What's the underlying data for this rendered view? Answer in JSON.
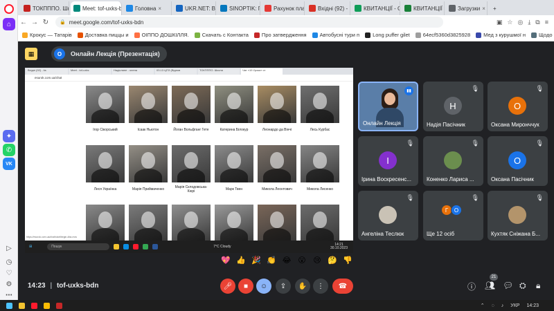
{
  "browser": {
    "tabs": [
      {
        "label": "ТОКПППО. Шко",
        "color": "#c5221f"
      },
      {
        "label": "Meet: tof-uxks-b",
        "color": "#00897b",
        "active": true
      },
      {
        "label": "Головна",
        "color": "#1e88e5"
      },
      {
        "label": "UKR.NET: Всі н",
        "color": "#1565c0"
      },
      {
        "label": "SINOPTIK: Пог",
        "color": "#0277bd"
      },
      {
        "label": "Рахунок платн",
        "color": "#e53935"
      },
      {
        "label": "Вхідні (92) - ks",
        "color": "#d93025"
      },
      {
        "label": "КВИТАНЦІЇ - G",
        "color": "#0f9d58"
      },
      {
        "label": "КВИТАНЦІЇ (Вс",
        "color": "#188038"
      },
      {
        "label": "Загрузки",
        "color": "#5f6368"
      }
    ],
    "url": "meet.google.com/tof-uxks-bdn",
    "bookmarks": [
      {
        "label": "Крокус — Татарів",
        "color": "#f9a825"
      },
      {
        "label": "Доставка пиццы и",
        "color": "#e65100"
      },
      {
        "label": "ОІППО ДОШКІЛЛЯ.",
        "color": "#ff7043"
      },
      {
        "label": "Скачать с Контакта",
        "color": "#7cb342"
      },
      {
        "label": "Про затвердження",
        "color": "#c62828"
      },
      {
        "label": "Автобусні тури п",
        "color": "#1e88e5"
      },
      {
        "label": "Long puffer gilet",
        "color": "#222222"
      },
      {
        "label": "64ecf5360d3825928",
        "color": "#9e9e9e"
      },
      {
        "label": "Мед з курушмої н",
        "color": "#3949ab"
      },
      {
        "label": "Щодо організації в",
        "color": "#546e7a"
      }
    ]
  },
  "meet": {
    "presenter_avatar": "О",
    "presenter_title": "Онлайн Лекція (Презентація)",
    "presentation": {
      "mini_tabs": [
        "Вхідні (92) - ks",
        "Meet - tof-uxks",
        "Надіслане - олена",
        "03.13 ЦПЗ (Відпов",
        "ТОКПППО. Школа",
        "Чат «19 Уроки» ст"
      ],
      "url": "esurok.com.ua/chat",
      "portraits": [
        {
          "name": "Ігор Сікорський",
          "tone": "#8a8a8a"
        },
        {
          "name": "Ісаак Ньютон",
          "tone": "#9a8770"
        },
        {
          "name": "Йоган Вольфганг Гете",
          "tone": "#7d6a56"
        },
        {
          "name": "Катерина Білокур",
          "tone": "#8f8f80"
        },
        {
          "name": "Леонардо да Вінчі",
          "tone": "#a88c62"
        },
        {
          "name": "Лесь Курбас",
          "tone": "#6f6f6f"
        },
        {
          "name": "Леся Українка",
          "tone": "#7a7a7a"
        },
        {
          "name": "Марія Приймаченко",
          "tone": "#948f86"
        },
        {
          "name": "Марія Склодовська-Кюрі",
          "tone": "#6b6b6b"
        },
        {
          "name": "Марк Твен",
          "tone": "#8c8c8c"
        },
        {
          "name": "Микола Леонтович",
          "tone": "#7a6f66"
        },
        {
          "name": "Микола Лисенко",
          "tone": "#858585"
        },
        {
          "name": "",
          "tone": "#8a8a8a"
        },
        {
          "name": "",
          "tone": "#7b7b7b"
        },
        {
          "name": "",
          "tone": "#8f8f8f"
        },
        {
          "name": "",
          "tone": "#9a9a9a"
        },
        {
          "name": "",
          "tone": "#7a6658"
        },
        {
          "name": "",
          "tone": "#6c6c6c"
        }
      ],
      "status_url": "https://esurok.com.ua/chat/start/begin-dba-mxs",
      "search_label": "Пошук",
      "weather": "7°C Cloudy",
      "mini_time": "14:21",
      "mini_date": "30.10.2023"
    },
    "participants": [
      {
        "name": "Онлайн Лекція",
        "kind": "video"
      },
      {
        "name": "Надія Пасічник",
        "initial": "Н",
        "color": "#5f6368"
      },
      {
        "name": "Оксана Миронччук",
        "initial": "О",
        "color": "#e8710a"
      },
      {
        "name": "Ірина Воскресенс...",
        "initial": "І",
        "color": "#8430ce"
      },
      {
        "name": "Коненко Лариса ...",
        "kind": "photo",
        "color": "#6b8e4e"
      },
      {
        "name": "Оксана Пасічник",
        "initial": "О",
        "color": "#1a73e8"
      },
      {
        "name": "Ангеліна Теслюк",
        "kind": "photo",
        "color": "#c9c2b5"
      },
      {
        "name": "Ще 12 осіб",
        "kind": "group"
      },
      {
        "name": "Кухтяк Сніжана Б...",
        "kind": "photo",
        "color": "#b3946b"
      }
    ],
    "group_initials": [
      "Г",
      "О"
    ],
    "reactions": [
      "💖",
      "👍",
      "🎉",
      "👏",
      "😂",
      "😮",
      "😢",
      "🤔",
      "👎"
    ],
    "time": "14:23",
    "meeting_id": "tof-uxks-bdn",
    "people_count": "21"
  },
  "taskbar": {
    "lang": "УКР",
    "time": "14:23"
  }
}
